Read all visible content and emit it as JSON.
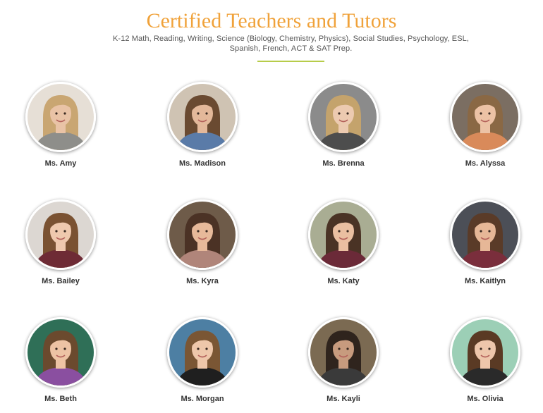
{
  "header": {
    "title": "Certified Teachers and Tutors",
    "subtitle": "K-12 Math, Reading, Writing, Science (Biology, Chemistry, Physics), Social Studies, Psychology, ESL, Spanish, French, ACT & SAT Prep."
  },
  "colors": {
    "title": "#f0a23a",
    "divider": "#b7cc4a",
    "name": "#333333"
  },
  "tutors": [
    {
      "name": "Ms. Amy",
      "bg": "#e6dfd6",
      "hair": "#c9a672",
      "skin": "#e9c3a6",
      "shirt": "#8e8e8a",
      "icon": "portrait-icon"
    },
    {
      "name": "Ms. Madison",
      "bg": "#cfc3b3",
      "hair": "#6a4a31",
      "skin": "#e3b89a",
      "shirt": "#5a7ba8",
      "icon": "portrait-icon"
    },
    {
      "name": "Ms. Brenna",
      "bg": "#8b8b8b",
      "hair": "#c4a36c",
      "skin": "#eccab0",
      "shirt": "#4d4d4d",
      "icon": "portrait-icon"
    },
    {
      "name": "Ms. Alyssa",
      "bg": "#7b6e62",
      "hair": "#8a6844",
      "skin": "#ecc2a5",
      "shirt": "#d98a5a",
      "icon": "portrait-icon"
    },
    {
      "name": "Ms. Bailey",
      "bg": "#dcd7d2",
      "hair": "#7a5232",
      "skin": "#efc9ae",
      "shirt": "#6e2b35",
      "icon": "portrait-icon"
    },
    {
      "name": "Ms. Kyra",
      "bg": "#6e5b49",
      "hair": "#4b3225",
      "skin": "#e7b99a",
      "shirt": "#b0857a",
      "icon": "portrait-icon"
    },
    {
      "name": "Ms. Katy",
      "bg": "#a9ad93",
      "hair": "#4a3325",
      "skin": "#eabfa1",
      "shirt": "#6b2a38",
      "icon": "portrait-icon"
    },
    {
      "name": "Ms. Kaitlyn",
      "bg": "#4c4f57",
      "hair": "#5a3b28",
      "skin": "#e6b797",
      "shirt": "#7a2e3c",
      "icon": "portrait-icon"
    },
    {
      "name": "Ms. Beth",
      "bg": "#2f6f57",
      "hair": "#6b4a2e",
      "skin": "#edc3a4",
      "shirt": "#8a4fa0",
      "icon": "portrait-icon"
    },
    {
      "name": "Ms. Morgan",
      "bg": "#4d7fa3",
      "hair": "#7a5634",
      "skin": "#eec7aa",
      "shirt": "#1f1f1f",
      "icon": "portrait-icon"
    },
    {
      "name": "Ms. Kayli",
      "bg": "#7b6a52",
      "hair": "#2f241d",
      "skin": "#c79b7e",
      "shirt": "#3a3a3a",
      "icon": "portrait-icon"
    },
    {
      "name": "Ms. Olivia",
      "bg": "#9ccfb6",
      "hair": "#5a3a24",
      "skin": "#eec6ab",
      "shirt": "#2a2a2a",
      "icon": "portrait-icon"
    }
  ]
}
